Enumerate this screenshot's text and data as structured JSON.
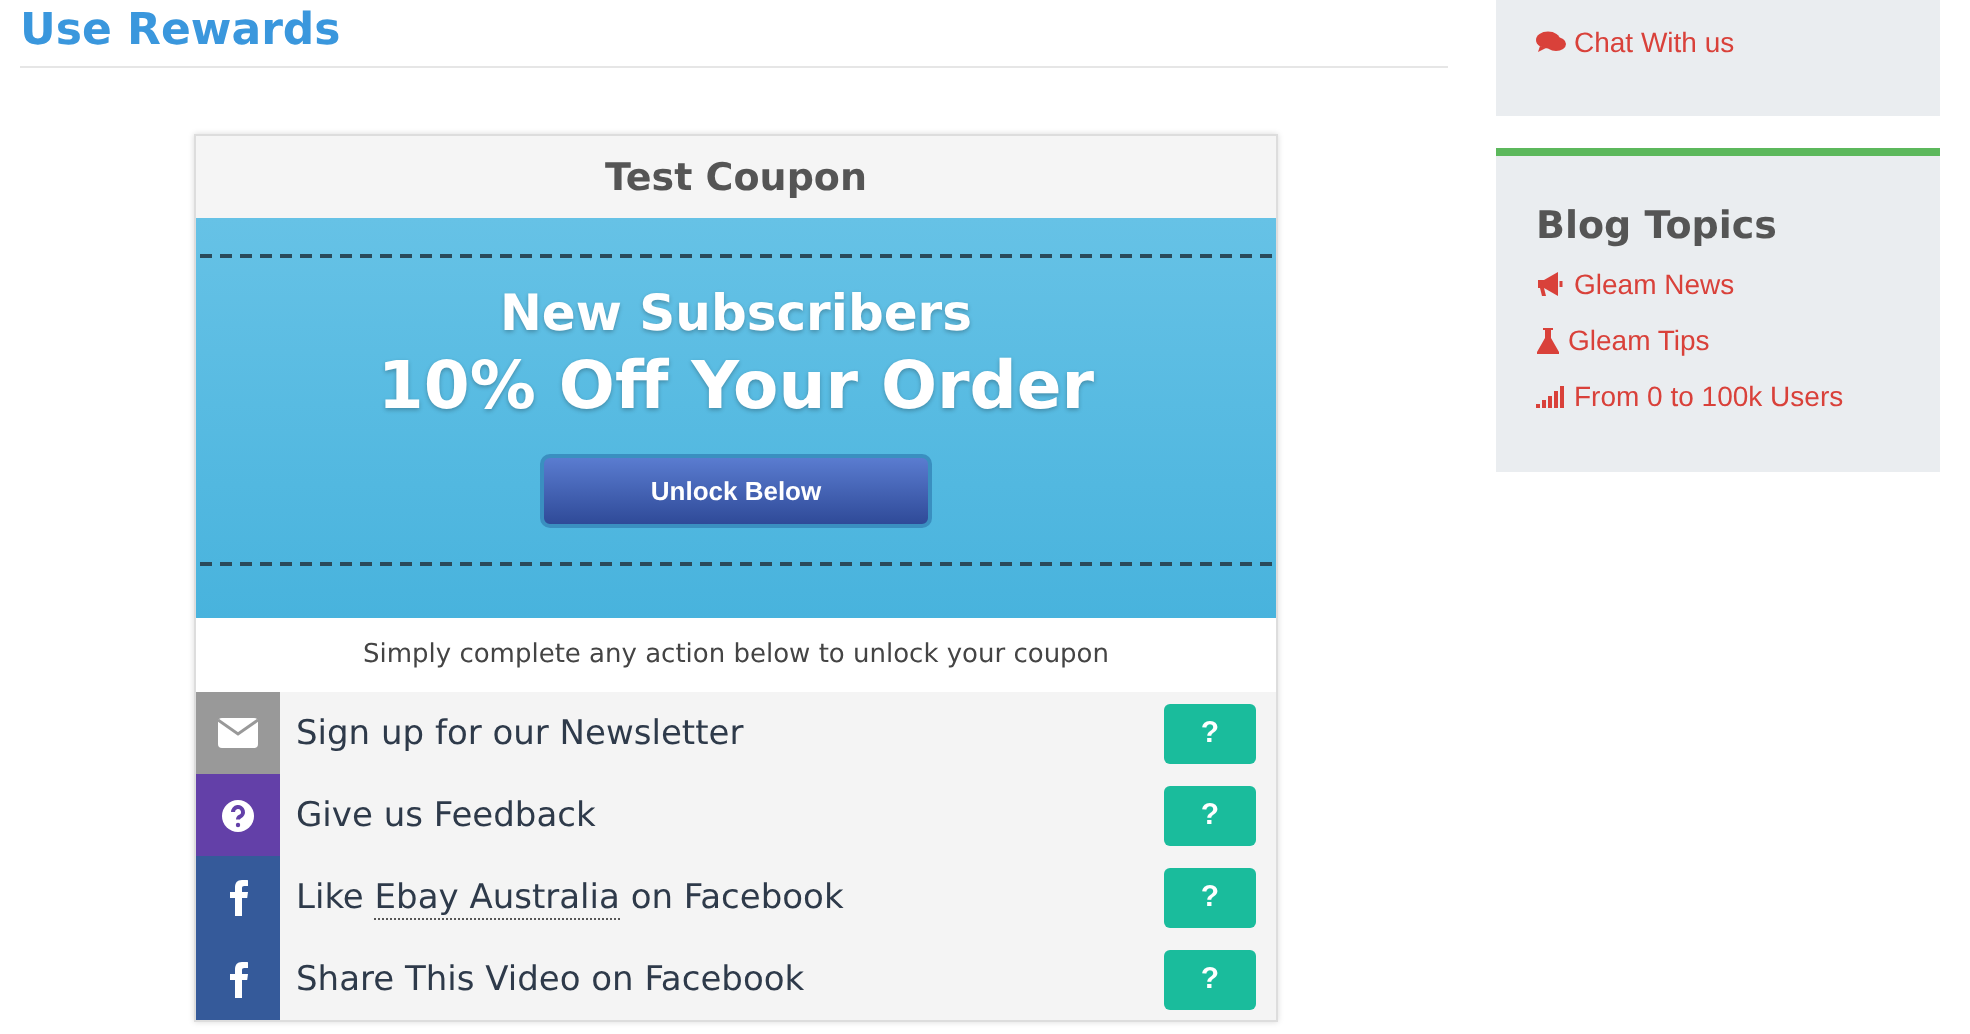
{
  "main": {
    "title": "Use Rewards",
    "coupon": {
      "title": "Test Coupon",
      "headline": "New Subscribers",
      "offer": "10% Off Your Order",
      "button": "Unlock Below",
      "instructions": "Simply complete any action below to unlock your coupon",
      "actions": [
        {
          "kind": "email",
          "text": "Sign up for our Newsletter",
          "help": "?"
        },
        {
          "kind": "question",
          "text": "Give us Feedback",
          "help": "?"
        },
        {
          "kind": "facebook",
          "text": "Like ",
          "link": "Ebay Australia",
          "text_after": " on Facebook",
          "help": "?"
        },
        {
          "kind": "facebook",
          "text": "Share This Video on Facebook",
          "help": "?"
        }
      ]
    }
  },
  "sidebar": {
    "chat": {
      "label": "Chat With us"
    },
    "blog": {
      "title": "Blog Topics",
      "items": [
        {
          "kind": "megaphone",
          "label": "Gleam News"
        },
        {
          "kind": "flask",
          "label": "Gleam Tips"
        },
        {
          "kind": "signal",
          "label": "From 0 to 100k Users"
        }
      ]
    }
  }
}
